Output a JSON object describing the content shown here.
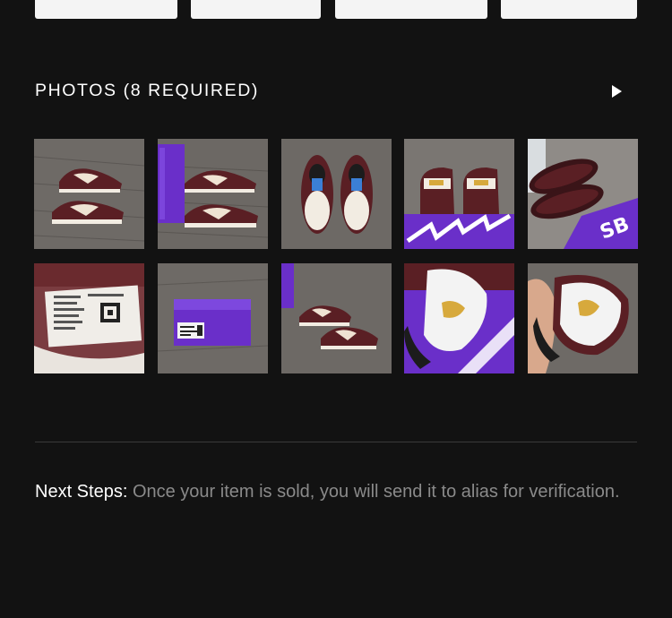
{
  "photos_section": {
    "title": "PHOTOS (8 REQUIRED)",
    "expand_icon": "play-right-icon"
  },
  "photos": [
    {
      "name": "photo-pair-side-wood-floor",
      "alt": "sneaker pair side view on wood floor"
    },
    {
      "name": "photo-pair-with-purple-box",
      "alt": "sneaker pair next to purple box"
    },
    {
      "name": "photo-pair-top-view",
      "alt": "sneaker pair top view"
    },
    {
      "name": "photo-heels-on-box",
      "alt": "sneaker heels on box"
    },
    {
      "name": "photo-soles-on-box",
      "alt": "sneaker soles on box"
    },
    {
      "name": "photo-size-tag",
      "alt": "inside size tag"
    },
    {
      "name": "photo-box-label",
      "alt": "purple box label"
    },
    {
      "name": "photo-pair-on-box-lid",
      "alt": "sneaker pair near box"
    },
    {
      "name": "photo-insole-logo",
      "alt": "insole gold logo"
    },
    {
      "name": "photo-insole-in-hand",
      "alt": "insole held in hand"
    }
  ],
  "next_steps": {
    "label": "Next Steps:",
    "text": " Once your item is sold, you will send it to alias for verification."
  },
  "colors": {
    "background": "#121212",
    "divider": "#3a3a3a",
    "muted_text": "#8a8a8a",
    "shoe_burgundy": "#5a1f24",
    "box_purple": "#6a2fc9"
  }
}
